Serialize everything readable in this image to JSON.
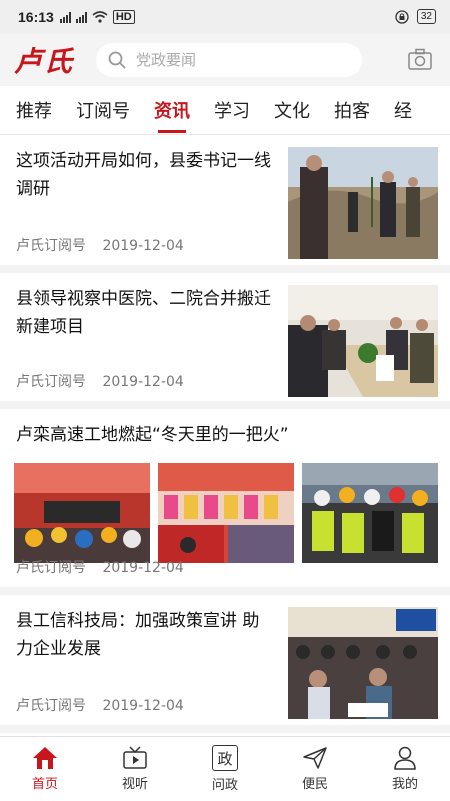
{
  "status_bar": {
    "time": "16:13",
    "network": "HD",
    "battery": "32"
  },
  "header": {
    "logo": "卢氏",
    "search_placeholder": "党政要闻"
  },
  "tabs": [
    {
      "label": "推荐"
    },
    {
      "label": "订阅号"
    },
    {
      "label": "资讯",
      "active": true
    },
    {
      "label": "学习"
    },
    {
      "label": "文化"
    },
    {
      "label": "拍客"
    },
    {
      "label": "经"
    }
  ],
  "articles": [
    {
      "title": "这项活动开局如何，县委书记一线调研",
      "source": "卢氏订阅号",
      "date": "2019-12-04"
    },
    {
      "title": "县领导视察中医院、二院合并搬迁新建项目",
      "source": "卢氏订阅号",
      "date": "2019-12-04"
    },
    {
      "title": "卢栾高速工地燃起“冬天里的一把火”",
      "source": "卢氏订阅号",
      "date": "2019-12-04"
    },
    {
      "title": "县工信科技局：加强政策宣讲 助力企业发展",
      "source": "卢氏订阅号",
      "date": "2019-12-04"
    }
  ],
  "bottom_nav": [
    {
      "label": "首页",
      "icon": "home-icon",
      "active": true
    },
    {
      "label": "视听",
      "icon": "tv-icon"
    },
    {
      "label": "问政",
      "icon": "zheng-icon",
      "glyph": "政"
    },
    {
      "label": "便民",
      "icon": "send-icon"
    },
    {
      "label": "我的",
      "icon": "user-icon"
    }
  ],
  "colors": {
    "accent": "#c8161d",
    "background": "#ffffff",
    "divider": "#f3f3f3"
  }
}
